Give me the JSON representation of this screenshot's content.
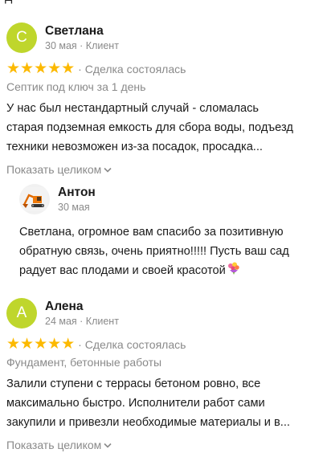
{
  "reviews": [
    {
      "initial": "С",
      "author": "Светлана",
      "meta": "30 мая · Клиент",
      "stars": "★★★★★",
      "status": "· Сделка состоялась",
      "service": "Септик под ключ за 1 день",
      "text_lines": [
        "У нас был нестандартный случай - сломалась",
        "старая подземная емкость для сбора воды, подъезд",
        "техники невозможен из-за посадок, просадка..."
      ],
      "show_more": "Показать целиком"
    },
    {
      "initial": "А",
      "author": "Алена",
      "meta": "24 мая · Клиент",
      "stars": "★★★★★",
      "status": "· Сделка состоялась",
      "service": "Фундамент, бетонные работы",
      "text_lines": [
        "Залили ступени с террасы бетоном ровно, все",
        "максимально быстро. Исполнители работ сами",
        "закупили и привезли необходимые материалы и в..."
      ],
      "show_more": "Показать целиком"
    }
  ],
  "reply": {
    "author": "Антон",
    "date": "30 мая",
    "text_lines": [
      "Светлана, огромное вам спасибо за позитивную",
      "обратную связь, очень приятно!!!!! Пусть ваш сад",
      "радует вас плодами и своей красотой"
    ],
    "emoji": "bouquet-emoji"
  },
  "colors": {
    "avatar": "#bfd62c",
    "star": "#fcb900",
    "muted": "#8a8a8a"
  }
}
